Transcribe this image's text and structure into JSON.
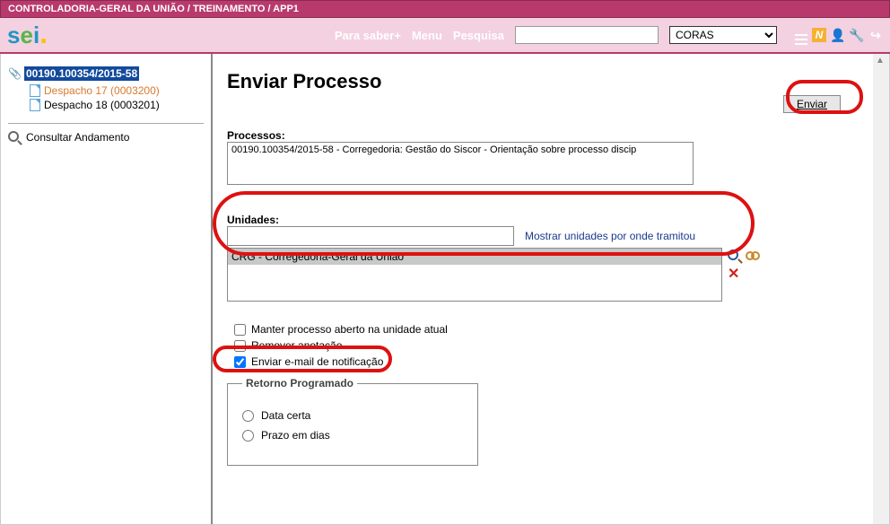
{
  "header": {
    "breadcrumb": "CONTROLADORIA-GERAL DA UNIÃO / TREINAMENTO / APP1",
    "logo_text": "sei",
    "nav": {
      "saber": "Para saber+",
      "menu": "Menu",
      "pesquisa": "Pesquisa"
    },
    "search_value": "",
    "unit_select": "CORAS"
  },
  "sidebar": {
    "process_number": "00190.100354/2015-58",
    "docs": [
      {
        "name": "Despacho 17 (0003200)",
        "selected": true
      },
      {
        "name": "Despacho 18 (0003201)",
        "selected": false
      }
    ],
    "consult": "Consultar Andamento"
  },
  "main": {
    "title": "Enviar Processo",
    "send_button": "Enviar",
    "processos_label": "Processos:",
    "processos_value": "00190.100354/2015-58 - Corregedoria: Gestão do Siscor - Orientação sobre processo discip",
    "unidades_label": "Unidades:",
    "unidades_input": "",
    "unidades_link": "Mostrar unidades por onde tramitou",
    "unidades_selected": "CRG - Corregedoria-Geral da União",
    "checks": {
      "manter": "Manter processo aberto na unidade atual",
      "remover": "Remover anotação",
      "email": "Enviar e-mail de notificação"
    },
    "retorno": {
      "legend": "Retorno Programado",
      "data_certa": "Data certa",
      "prazo": "Prazo em dias"
    }
  }
}
